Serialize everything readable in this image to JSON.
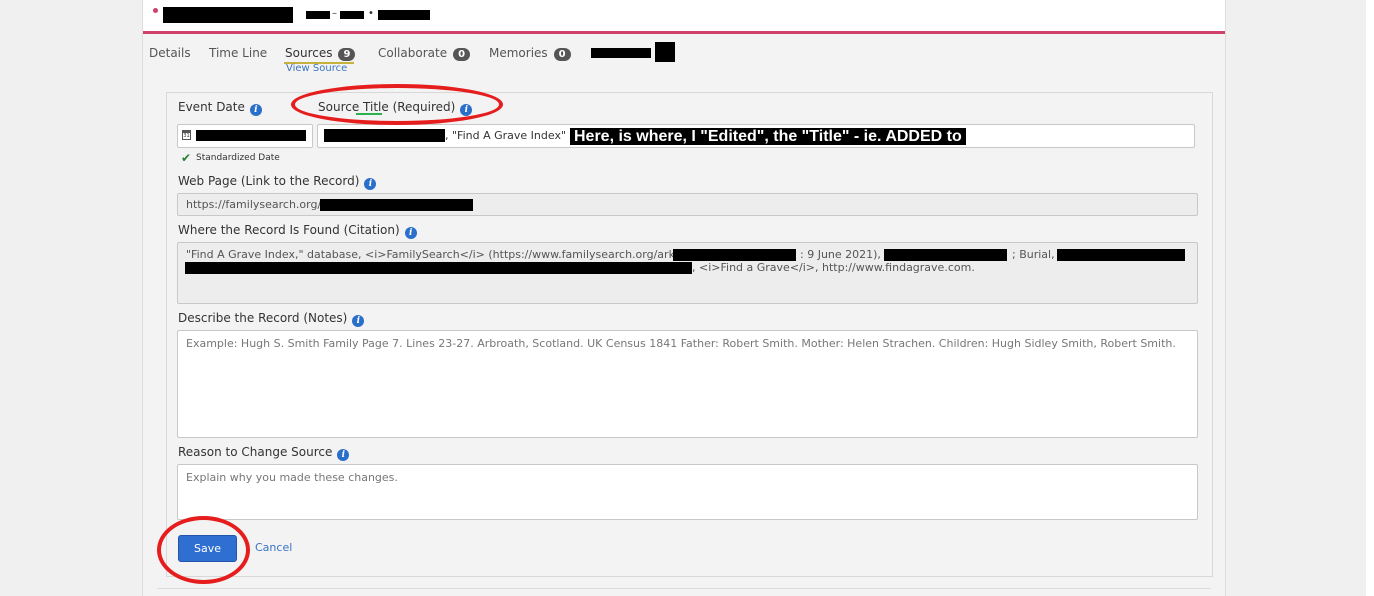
{
  "header": {
    "dates_separator": "–",
    "dates_bullet": "•"
  },
  "tabs": [
    {
      "label": "Details"
    },
    {
      "label": "Time Line"
    },
    {
      "label": "Sources",
      "count": "9"
    },
    {
      "label": "Collaborate",
      "count": "0"
    },
    {
      "label": "Memories",
      "count": "0"
    }
  ],
  "view_source": "View Source",
  "form": {
    "event_date_label": "Event Date",
    "source_title_label_part1": "Source ",
    "source_title_label_part2": "Title",
    "source_title_label_part3": " (Required)",
    "source_title_suffix": ", \"Find A Grave Index\"",
    "annotation_text": "Here, is where, I \"Edited\", the \"Title\" - ie. ADDED to",
    "standardized_date": "Standardized Date",
    "web_page_label": "Web Page (Link to the Record)",
    "web_page_value": "https://familysearch.org/ark:/",
    "citation_label": "Where the Record Is Found (Citation)",
    "citation_line1_a": "\"Find A Grave Index,\" database, <i>FamilySearch</i> (https://www.familysearch.org/ark:/",
    "citation_line1_b": ": 9 June 2021),",
    "citation_line1_c": "; Burial,",
    "citation_line2": ", <i>Find a Grave</i>, http://www.findagrave.com.",
    "notes_label": "Describe the Record (Notes)",
    "notes_placeholder": "Example: Hugh S. Smith Family Page 7. Lines 23-27. Arbroath, Scotland. UK Census 1841 Father: Robert Smith. Mother: Helen Strachen. Children: Hugh Sidley Smith, Robert Smith.",
    "reason_label": "Reason to Change Source",
    "reason_placeholder": "Explain why you made these changes.",
    "save_label": "Save",
    "cancel_label": "Cancel",
    "calendar_day": "31"
  },
  "colors": {
    "accent": "#d0426c",
    "primary_button": "#2f6fd1",
    "link": "#3b74c2",
    "annotation_red": "#e61d1d"
  }
}
